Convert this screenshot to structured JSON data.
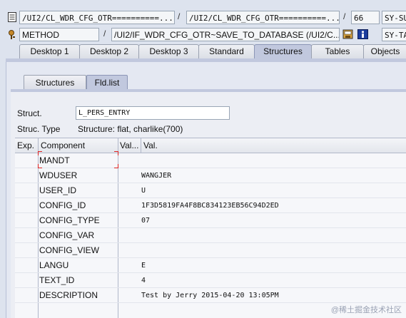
{
  "toolbar": {
    "row1": {
      "field1": "/UI2/CL_WDR_CFG_OTR==========...",
      "sep1": "/",
      "field2": "/UI2/CL_WDR_CFG_OTR==========...",
      "sep2": "/",
      "field3": "66",
      "field4": "SY-SU"
    },
    "row2": {
      "field1": "METHOD",
      "sep1": "/",
      "field2": "/UI2/IF_WDR_CFG_OTR~SAVE_TO_DATABASE (/UI2/C...",
      "field3": "SY-TA"
    }
  },
  "tabs": [
    {
      "label": "Desktop 1",
      "active": false
    },
    {
      "label": "Desktop 2",
      "active": false
    },
    {
      "label": "Desktop 3",
      "active": false
    },
    {
      "label": "Standard",
      "active": false
    },
    {
      "label": "Structures",
      "active": true
    },
    {
      "label": "Tables",
      "active": false
    },
    {
      "label": "Objects",
      "active": false
    }
  ],
  "subtabs": [
    {
      "label": "Structures",
      "active": false
    },
    {
      "label": "Fld.list",
      "active": true
    }
  ],
  "form": {
    "struct_label": "Struct.",
    "struct_value": "L_PERS_ENTRY",
    "struc_type_label": "Struc. Type",
    "struc_type_value": "Structure: flat, charlike(700)"
  },
  "table": {
    "headers": {
      "exp": "Exp.",
      "component": "Component",
      "val_short": "Val...",
      "val": "Val."
    },
    "rows": [
      {
        "component": "MANDT",
        "value": ""
      },
      {
        "component": "WDUSER",
        "value": "WANGJER"
      },
      {
        "component": "USER_ID",
        "value": "U"
      },
      {
        "component": "CONFIG_ID",
        "value": "1F3D5819FA4F8BC834123EB56C94D2ED"
      },
      {
        "component": "CONFIG_TYPE",
        "value": "07"
      },
      {
        "component": "CONFIG_VAR",
        "value": ""
      },
      {
        "component": "CONFIG_VIEW",
        "value": ""
      },
      {
        "component": "LANGU",
        "value": "E"
      },
      {
        "component": "TEXT_ID",
        "value": "4"
      },
      {
        "component": "DESCRIPTION",
        "value": "Test by Jerry 2015-04-20 13:05PM"
      }
    ]
  },
  "watermark": "@稀土掘金技术社区",
  "colors": {
    "active_tab": "#c1c8de",
    "panel": "#e4e8f2",
    "focus": "#dd2222"
  }
}
